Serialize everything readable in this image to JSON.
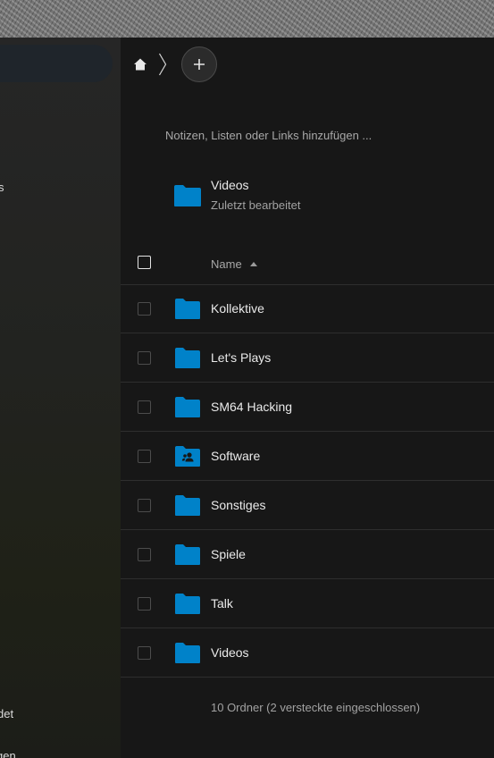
{
  "breadcrumb": {
    "home_icon": "home-icon",
    "separator_icon": "chevron-right-icon",
    "add_icon": "plus-icon"
  },
  "sidebar": {
    "fragments": [
      "s",
      "det",
      "gen"
    ]
  },
  "rich_workspace": {
    "placeholder": "Notizen, Listen oder Links hinzufügen ..."
  },
  "recent": {
    "name": "Videos",
    "subtitle": "Zuletzt bearbeitet"
  },
  "table": {
    "header_name": "Name",
    "sort_icon": "sort-ascending-icon",
    "rows": [
      {
        "name": "Kollektive",
        "icon": "folder-icon"
      },
      {
        "name": "Let's Plays",
        "icon": "folder-icon"
      },
      {
        "name": "SM64 Hacking",
        "icon": "folder-icon"
      },
      {
        "name": "Software",
        "icon": "shared-folder-icon"
      },
      {
        "name": "Sonstiges",
        "icon": "folder-icon"
      },
      {
        "name": "Spiele",
        "icon": "folder-icon"
      },
      {
        "name": "Talk",
        "icon": "folder-icon"
      },
      {
        "name": "Videos",
        "icon": "folder-icon"
      }
    ],
    "summary": "10 Ordner (2 versteckte eingeschlossen)"
  },
  "colors": {
    "accent": "#0082c9",
    "background": "#171717",
    "sidebar": "#262626"
  }
}
